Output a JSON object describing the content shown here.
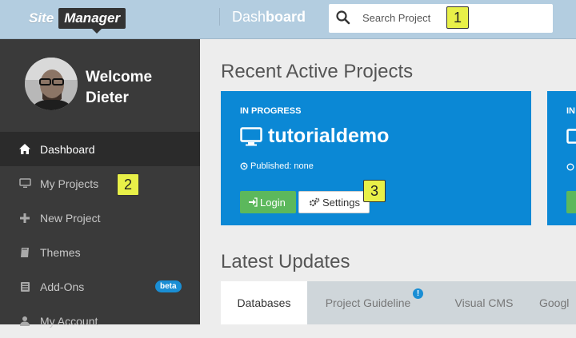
{
  "header": {
    "logo_site": "Site",
    "logo_manager": "Manager",
    "title_light": "Dash",
    "title_bold": "board",
    "search_placeholder": "Search Project",
    "callout": "1"
  },
  "user": {
    "greeting": "Welcome",
    "name": "Dieter"
  },
  "sidebar": {
    "items": [
      {
        "label": "Dashboard",
        "icon": "home-icon",
        "active": true
      },
      {
        "label": "My Projects",
        "icon": "monitor-icon"
      },
      {
        "label": "New Project",
        "icon": "plus-icon"
      },
      {
        "label": "Themes",
        "icon": "book-icon"
      },
      {
        "label": "Add-Ons",
        "icon": "puzzle-icon",
        "badge": "beta"
      },
      {
        "label": "My Account",
        "icon": "user-icon"
      }
    ],
    "callout": "2"
  },
  "main": {
    "recent_heading": "Recent Active Projects",
    "card": {
      "status": "IN PROGRESS",
      "name": "tutorialdemo",
      "published": "Published: none",
      "login_label": "Login",
      "settings_label": "Settings",
      "callout": "3"
    },
    "card2": {
      "status": "IN"
    },
    "updates_heading": "Latest Updates",
    "tabs": [
      {
        "label": "Databases",
        "active": true
      },
      {
        "label": "Project Guideline",
        "info": "!"
      },
      {
        "label": "Visual CMS"
      },
      {
        "label": "Googl"
      }
    ]
  },
  "colors": {
    "topbar": "#b3cde0",
    "sidebar": "#3a3a3a",
    "card": "#0b88d5",
    "login": "#5cb85c",
    "badge": "#e8f048",
    "beta": "#1a8ed4"
  }
}
